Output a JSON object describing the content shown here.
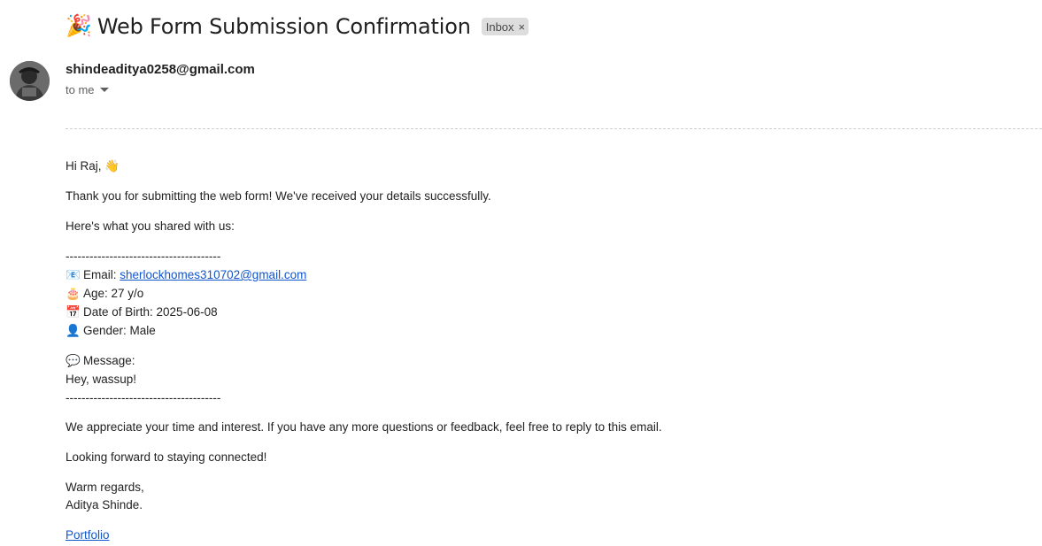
{
  "email": {
    "subject_emoji": "🎉",
    "subject": "Web Form Submission Confirmation",
    "label_chip": "Inbox",
    "label_chip_close": "×",
    "sender": "shindeaditya0258@gmail.com",
    "recipient": "to me",
    "body": {
      "greeting": "Hi Raj, 👋",
      "thanks": "Thank you for submitting the web form! We've received your details successfully.",
      "intro": "Here's what you shared with us:",
      "separator": "---------------------------------------",
      "email_emoji": "📧",
      "email_label": "Email: ",
      "email_value": "sherlockhomes310702@gmail.com",
      "age_emoji": "🎂",
      "age_text": "Age: 27 y/o",
      "dob_emoji": "📅",
      "dob_text": "Date of Birth: 2025-06-08",
      "gender_emoji": "👤",
      "gender_text": "Gender: Male",
      "message_emoji": "💬",
      "message_label": "Message:",
      "message_text": "Hey, wassup!",
      "separator_end": "---------------------------------------",
      "appreciation": "We appreciate your time and interest. If you have any more questions or feedback, feel free to reply to this email.",
      "closing": "Looking forward to staying connected!",
      "regards": "Warm regards,",
      "signature": "Aditya Shinde.",
      "portfolio_link": "Portfolio"
    }
  }
}
